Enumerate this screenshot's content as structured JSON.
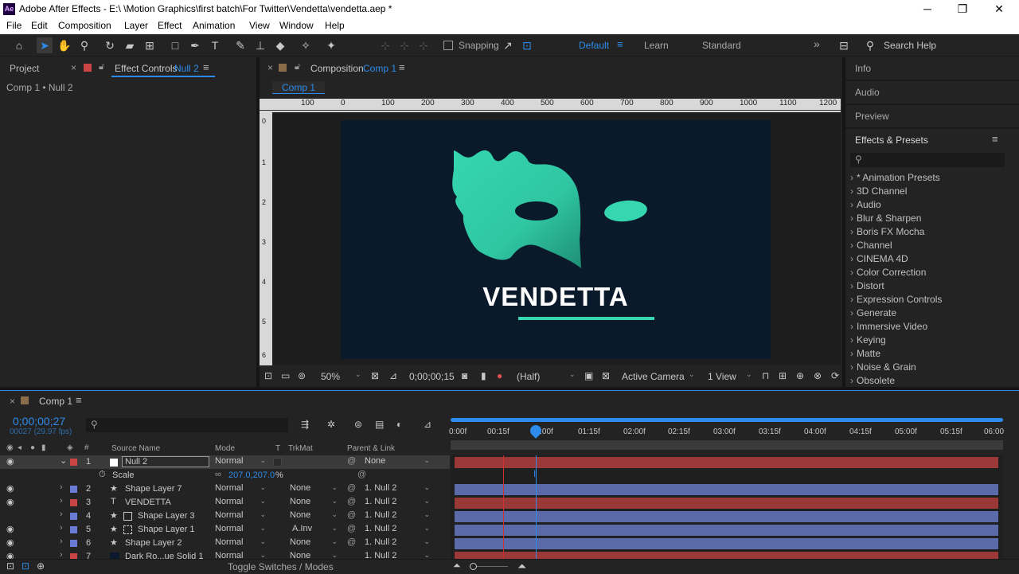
{
  "window": {
    "app_icon_text": "Ae",
    "title": "Adobe After Effects - E:\\ \\Motion Graphics\\first batch\\For Twitter\\Vendetta\\vendetta.aep *",
    "minimize": "─",
    "maximize": "❐",
    "close": "✕"
  },
  "menu": [
    "File",
    "Edit",
    "Composition",
    "Layer",
    "Effect",
    "Animation",
    "View",
    "Window",
    "Help"
  ],
  "toolbar": {
    "snapping_label": "Snapping",
    "workspaces": [
      "Default",
      "Learn",
      "Standard"
    ],
    "search_placeholder": "Search Help"
  },
  "left_panel": {
    "tab_project": "Project",
    "tab_effect_controls": "Effect Controls",
    "tab_effect_controls_target": "Null 2",
    "breadcrumb": "Comp 1 • Null 2"
  },
  "comp_panel": {
    "tab_label": "Composition",
    "tab_target": "Comp 1",
    "sub_tab": "Comp 1",
    "ruler_ticks": [
      "100",
      "0",
      "100",
      "200",
      "300",
      "400",
      "500",
      "600",
      "700",
      "800",
      "900",
      "1000",
      "1100",
      "1200"
    ],
    "vruler_ticks": [
      "0",
      "1",
      "2",
      "3",
      "4",
      "5",
      "6"
    ],
    "viewer_title": "VENDETTA",
    "mask_color": "#35d6b0",
    "bg_color": "#0b1a2a",
    "footer": {
      "zoom": "50%",
      "timecode": "0;00;00;15",
      "resolution": "(Half)",
      "camera": "Active Camera",
      "views": "1 View"
    }
  },
  "right_panel": {
    "sections": [
      "Info",
      "Audio",
      "Preview"
    ],
    "effects_title": "Effects & Presets",
    "search_placeholder": "",
    "effects": [
      "* Animation Presets",
      "3D Channel",
      "Audio",
      "Blur & Sharpen",
      "Boris FX Mocha",
      "Channel",
      "CINEMA 4D",
      "Color Correction",
      "Distort",
      "Expression Controls",
      "Generate",
      "Immersive Video",
      "Keying",
      "Matte",
      "Noise & Grain",
      "Obsolete"
    ]
  },
  "timeline": {
    "tab_label": "Comp 1",
    "timecode": "0;00;00;27",
    "frame_info": "00027 (29.97 fps)",
    "headers": {
      "source_name": "Source Name",
      "mode": "Mode",
      "t": "T",
      "trkmat": "TrkMat",
      "parent": "Parent & Link"
    },
    "ruler": [
      "0:00f",
      "00:15f",
      "01:00f",
      "01:15f",
      "02:00f",
      "02:15f",
      "03:00f",
      "03:15f",
      "04:00f",
      "04:15f",
      "05:00f",
      "05:15f",
      "06:00"
    ],
    "layers": [
      {
        "num": "1",
        "name": "Null 2",
        "mode": "Normal",
        "trkmat": "",
        "parent": "None",
        "color": "#c94545",
        "bar_color": "#9b3838",
        "selected": true
      },
      {
        "num": "2",
        "name": "Shape Layer 7",
        "mode": "Normal",
        "trkmat": "None",
        "parent": "1. Null 2",
        "color": "#6a7bd6",
        "bar_color": "#5b6aa8"
      },
      {
        "num": "3",
        "name": "VENDETTA",
        "mode": "Normal",
        "trkmat": "None",
        "parent": "1. Null 2",
        "color": "#c94545",
        "bar_color": "#9b3838"
      },
      {
        "num": "4",
        "name": "Shape Layer 3",
        "mode": "Normal",
        "trkmat": "None",
        "parent": "1. Null 2",
        "color": "#6a7bd6",
        "bar_color": "#5b6aa8"
      },
      {
        "num": "5",
        "name": "Shape Layer 1",
        "mode": "Normal",
        "trkmat": "A.Inv",
        "parent": "1. Null 2",
        "color": "#6a7bd6",
        "bar_color": "#5b6aa8"
      },
      {
        "num": "6",
        "name": "Shape Layer 2",
        "mode": "Normal",
        "trkmat": "None",
        "parent": "1. Null 2",
        "color": "#6a7bd6",
        "bar_color": "#5b6aa8"
      },
      {
        "num": "7",
        "name": "Dark Ro...ue Solid 1",
        "mode": "Normal",
        "trkmat": "None",
        "parent": "1. Null 2",
        "color": "#c94545",
        "bar_color": "#9b3838"
      }
    ],
    "scale_property": {
      "label": "Scale",
      "value": "207.0,207.0",
      "unit": "%"
    },
    "toggle_label": "Toggle Switches / Modes"
  }
}
